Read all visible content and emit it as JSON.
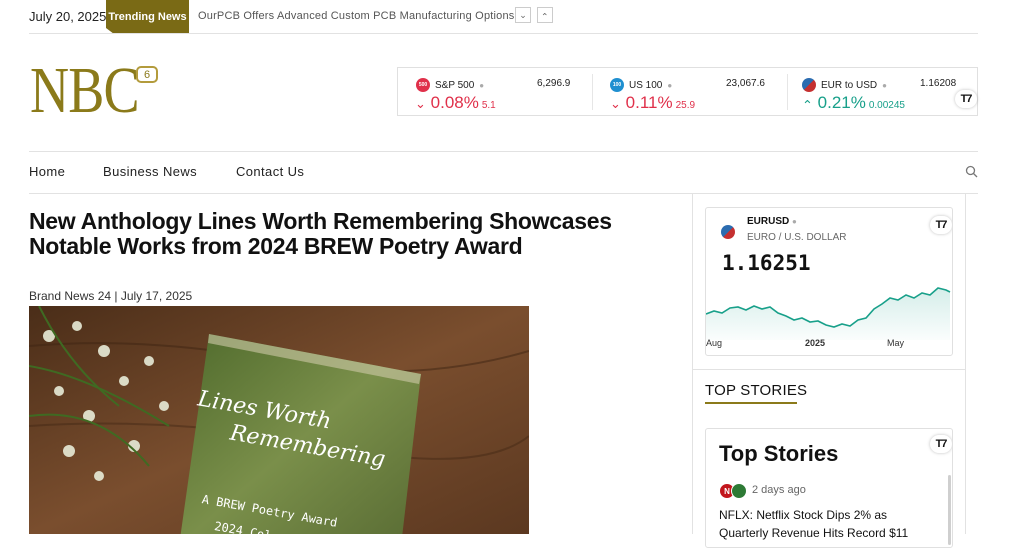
{
  "topbar": {
    "date": "July 20, 2025",
    "trending_label": "Trending News",
    "trending_headline": "OurPCB Offers Advanced Custom PCB Manufacturing Options"
  },
  "logo": {
    "text": "NBC",
    "badge": "6"
  },
  "ticker": [
    {
      "icon_text": "500",
      "icon_color": "#e0304a",
      "name": "S&P 500",
      "price": "6,296.9",
      "change": "0.08%",
      "abs_change": "5.1",
      "direction": "down"
    },
    {
      "icon_text": "100",
      "icon_color": "#1f8fd0",
      "name": "US 100",
      "price": "23,067.6",
      "change": "0.11%",
      "abs_change": "25.9",
      "direction": "down"
    },
    {
      "icon_text": "",
      "icon_color": "#2b6cb0",
      "name": "EUR to USD",
      "price": "1.16208",
      "change": "0.21%",
      "abs_change": "0.00245",
      "direction": "up"
    }
  ],
  "nav": [
    {
      "label": "Home"
    },
    {
      "label": "Business News"
    },
    {
      "label": "Contact Us"
    }
  ],
  "article": {
    "title": "New Anthology Lines Worth Remembering Showcases Notable Works from 2024 BREW Poetry Award",
    "byline": "Brand News 24 | July 17, 2025",
    "book_title_line1": "Lines Worth",
    "book_title_line2": "Remembering",
    "book_sub1": "A BREW Poetry Award",
    "book_sub2": "2024 Col"
  },
  "eurusd_widget": {
    "symbol": "EURUSD",
    "description": "EURO / U.S. DOLLAR",
    "price": "1.16251",
    "axis_labels": [
      "Aug",
      "2025",
      "May"
    ]
  },
  "top_stories": {
    "heading": "TOP STORIES",
    "widget_title": "Top Stories",
    "item_time": "2 days ago",
    "item_text": "NFLX: Netflix Stock Dips 2% as Quarterly Revenue Hits Record $11"
  },
  "colors": {
    "accent": "#8b7a1a",
    "down": "#e0304a",
    "up": "#18a08a"
  }
}
